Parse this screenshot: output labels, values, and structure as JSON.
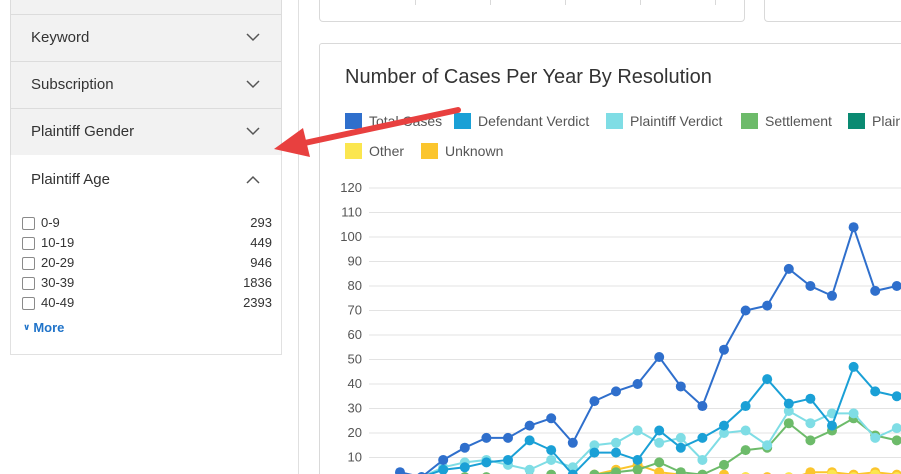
{
  "sidebar": {
    "sections": [
      {
        "label": "Keyword"
      },
      {
        "label": "Subscription"
      },
      {
        "label": "Plaintiff Gender"
      }
    ],
    "age": {
      "title": "Plaintiff Age",
      "rows": [
        {
          "label": "0-9",
          "count": "293"
        },
        {
          "label": "10-19",
          "count": "449"
        },
        {
          "label": "20-29",
          "count": "946"
        },
        {
          "label": "30-39",
          "count": "1836"
        },
        {
          "label": "40-49",
          "count": "2393"
        }
      ],
      "more_label": "More"
    }
  },
  "colors": {
    "accent_link": "#1f73c9",
    "annotation_arrow": "#e8403f"
  },
  "chart_data": {
    "type": "line",
    "title": "Number of Cases Per Year By Resolution",
    "ylim": [
      0,
      120
    ],
    "yticks": [
      10,
      20,
      30,
      40,
      50,
      60,
      70,
      80,
      90,
      100,
      110,
      120
    ],
    "grid": true,
    "legend_placement": "top-left",
    "legend": [
      {
        "name": "Total Cases",
        "color": "#2f6fcc"
      },
      {
        "name": "Defendant Verdict",
        "color": "#1aa0d6"
      },
      {
        "name": "Plaintiff Verdict",
        "color": "#7fdde5"
      },
      {
        "name": "Settlement",
        "color": "#6dbb6a"
      },
      {
        "name": "Plaintiff",
        "color": "#0a8a72"
      },
      {
        "name": "Other",
        "color": "#fbe64f"
      },
      {
        "name": "Unknown",
        "color": "#fbc52d"
      }
    ],
    "series": [
      {
        "name": "Total Cases",
        "color": "#2f6fcc",
        "values": [
          4,
          2,
          9,
          14,
          18,
          18,
          23,
          26,
          16,
          33,
          37,
          40,
          51,
          39,
          31,
          54,
          70,
          72,
          87,
          80,
          76,
          104,
          78,
          80
        ]
      },
      {
        "name": "Defendant Verdict",
        "color": "#1aa0d6",
        "values": [
          1,
          2,
          5,
          6,
          8,
          9,
          17,
          13,
          3,
          12,
          12,
          9,
          21,
          14,
          18,
          23,
          31,
          42,
          32,
          34,
          23,
          47,
          37,
          35
        ]
      },
      {
        "name": "Plaintiff Verdict",
        "color": "#7fdde5",
        "values": [
          0,
          2,
          6,
          8,
          9,
          7,
          5,
          9,
          6,
          15,
          16,
          21,
          16,
          18,
          9,
          20,
          21,
          15,
          29,
          24,
          28,
          28,
          18,
          22
        ]
      },
      {
        "name": "Settlement",
        "color": "#6dbb6a",
        "values": [
          0,
          0,
          1,
          2,
          2,
          1,
          2,
          3,
          2,
          3,
          4,
          5,
          8,
          4,
          3,
          7,
          13,
          14,
          24,
          17,
          21,
          26,
          19,
          17
        ]
      },
      {
        "name": "Other",
        "color": "#fbe64f",
        "values": [
          0,
          0,
          0,
          0,
          0,
          0,
          0,
          1,
          0,
          1,
          1,
          2,
          1,
          1,
          0,
          1,
          2,
          1,
          2,
          1,
          3,
          2,
          3,
          2
        ]
      },
      {
        "name": "Unknown",
        "color": "#fbc52d",
        "values": [
          0,
          0,
          0,
          0,
          0,
          0,
          0,
          2,
          0,
          3,
          5,
          7,
          4,
          3,
          2,
          3,
          2,
          2,
          1,
          4,
          4,
          3,
          4,
          3
        ]
      }
    ]
  }
}
